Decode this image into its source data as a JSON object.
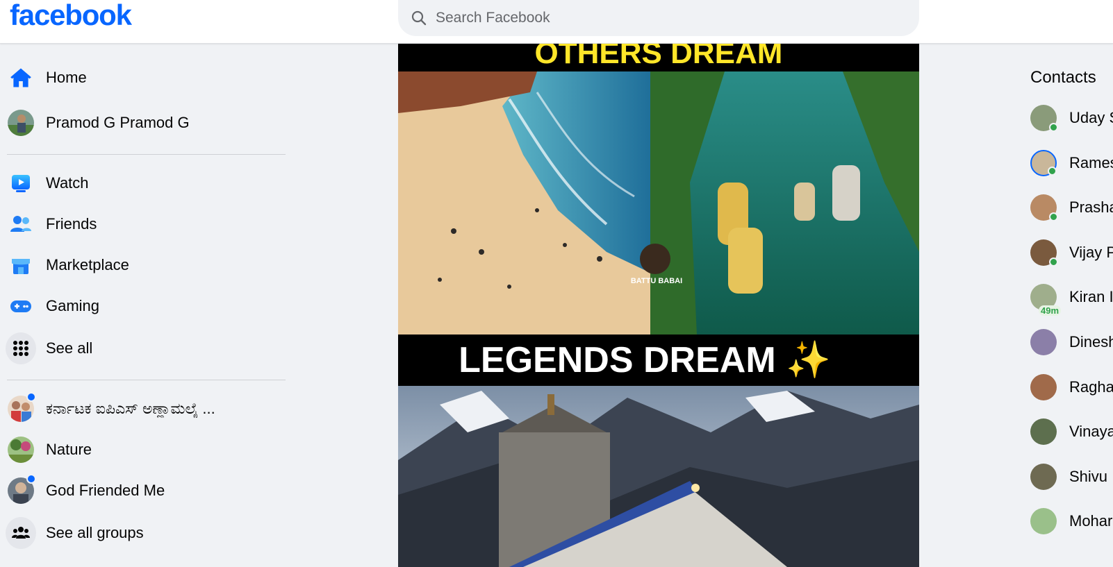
{
  "header": {
    "logo": "facebook",
    "search_placeholder": "Search Facebook"
  },
  "left_nav": {
    "items": [
      {
        "label": "Home",
        "icon": "home-icon"
      },
      {
        "label": "Pramod G Pramod G",
        "icon": "avatar"
      },
      {
        "label": "Watch",
        "icon": "watch-icon"
      },
      {
        "label": "Friends",
        "icon": "friends-icon"
      },
      {
        "label": "Marketplace",
        "icon": "marketplace-icon"
      },
      {
        "label": "Gaming",
        "icon": "gaming-icon"
      },
      {
        "label": "See all",
        "icon": "grid-icon"
      }
    ],
    "groups": [
      {
        "label": "ಕರ್ನಾಟಕ ಐಪಿಎಸ್ ಅಣ್ಣಾಮಲೈ ...",
        "unread": true
      },
      {
        "label": "Nature",
        "unread": false
      },
      {
        "label": "God Friended Me",
        "unread": true
      },
      {
        "label": "See all groups",
        "icon": "groups-icon"
      }
    ]
  },
  "feed": {
    "top_banner": "OTHERS DREAM",
    "middle_banner": "LEGENDS DREAM ✨",
    "sticker_text": "BATTU BABAI"
  },
  "contacts": {
    "title": "Contacts",
    "items": [
      {
        "name": "Uday S",
        "online": true
      },
      {
        "name": "Rames",
        "online": true
      },
      {
        "name": "Prasha",
        "online": true
      },
      {
        "name": "Vijay P",
        "online": true
      },
      {
        "name": "Kiran I",
        "online": false,
        "last_active": "49m"
      },
      {
        "name": "Dinesh",
        "online": false
      },
      {
        "name": "Ragha",
        "online": false
      },
      {
        "name": "Vinaya",
        "online": false
      },
      {
        "name": "Shivu",
        "online": false
      },
      {
        "name": "Mohar",
        "online": false
      }
    ]
  },
  "colors": {
    "brand": "#0866ff",
    "background": "#f0f2f5",
    "online": "#31a24c"
  }
}
